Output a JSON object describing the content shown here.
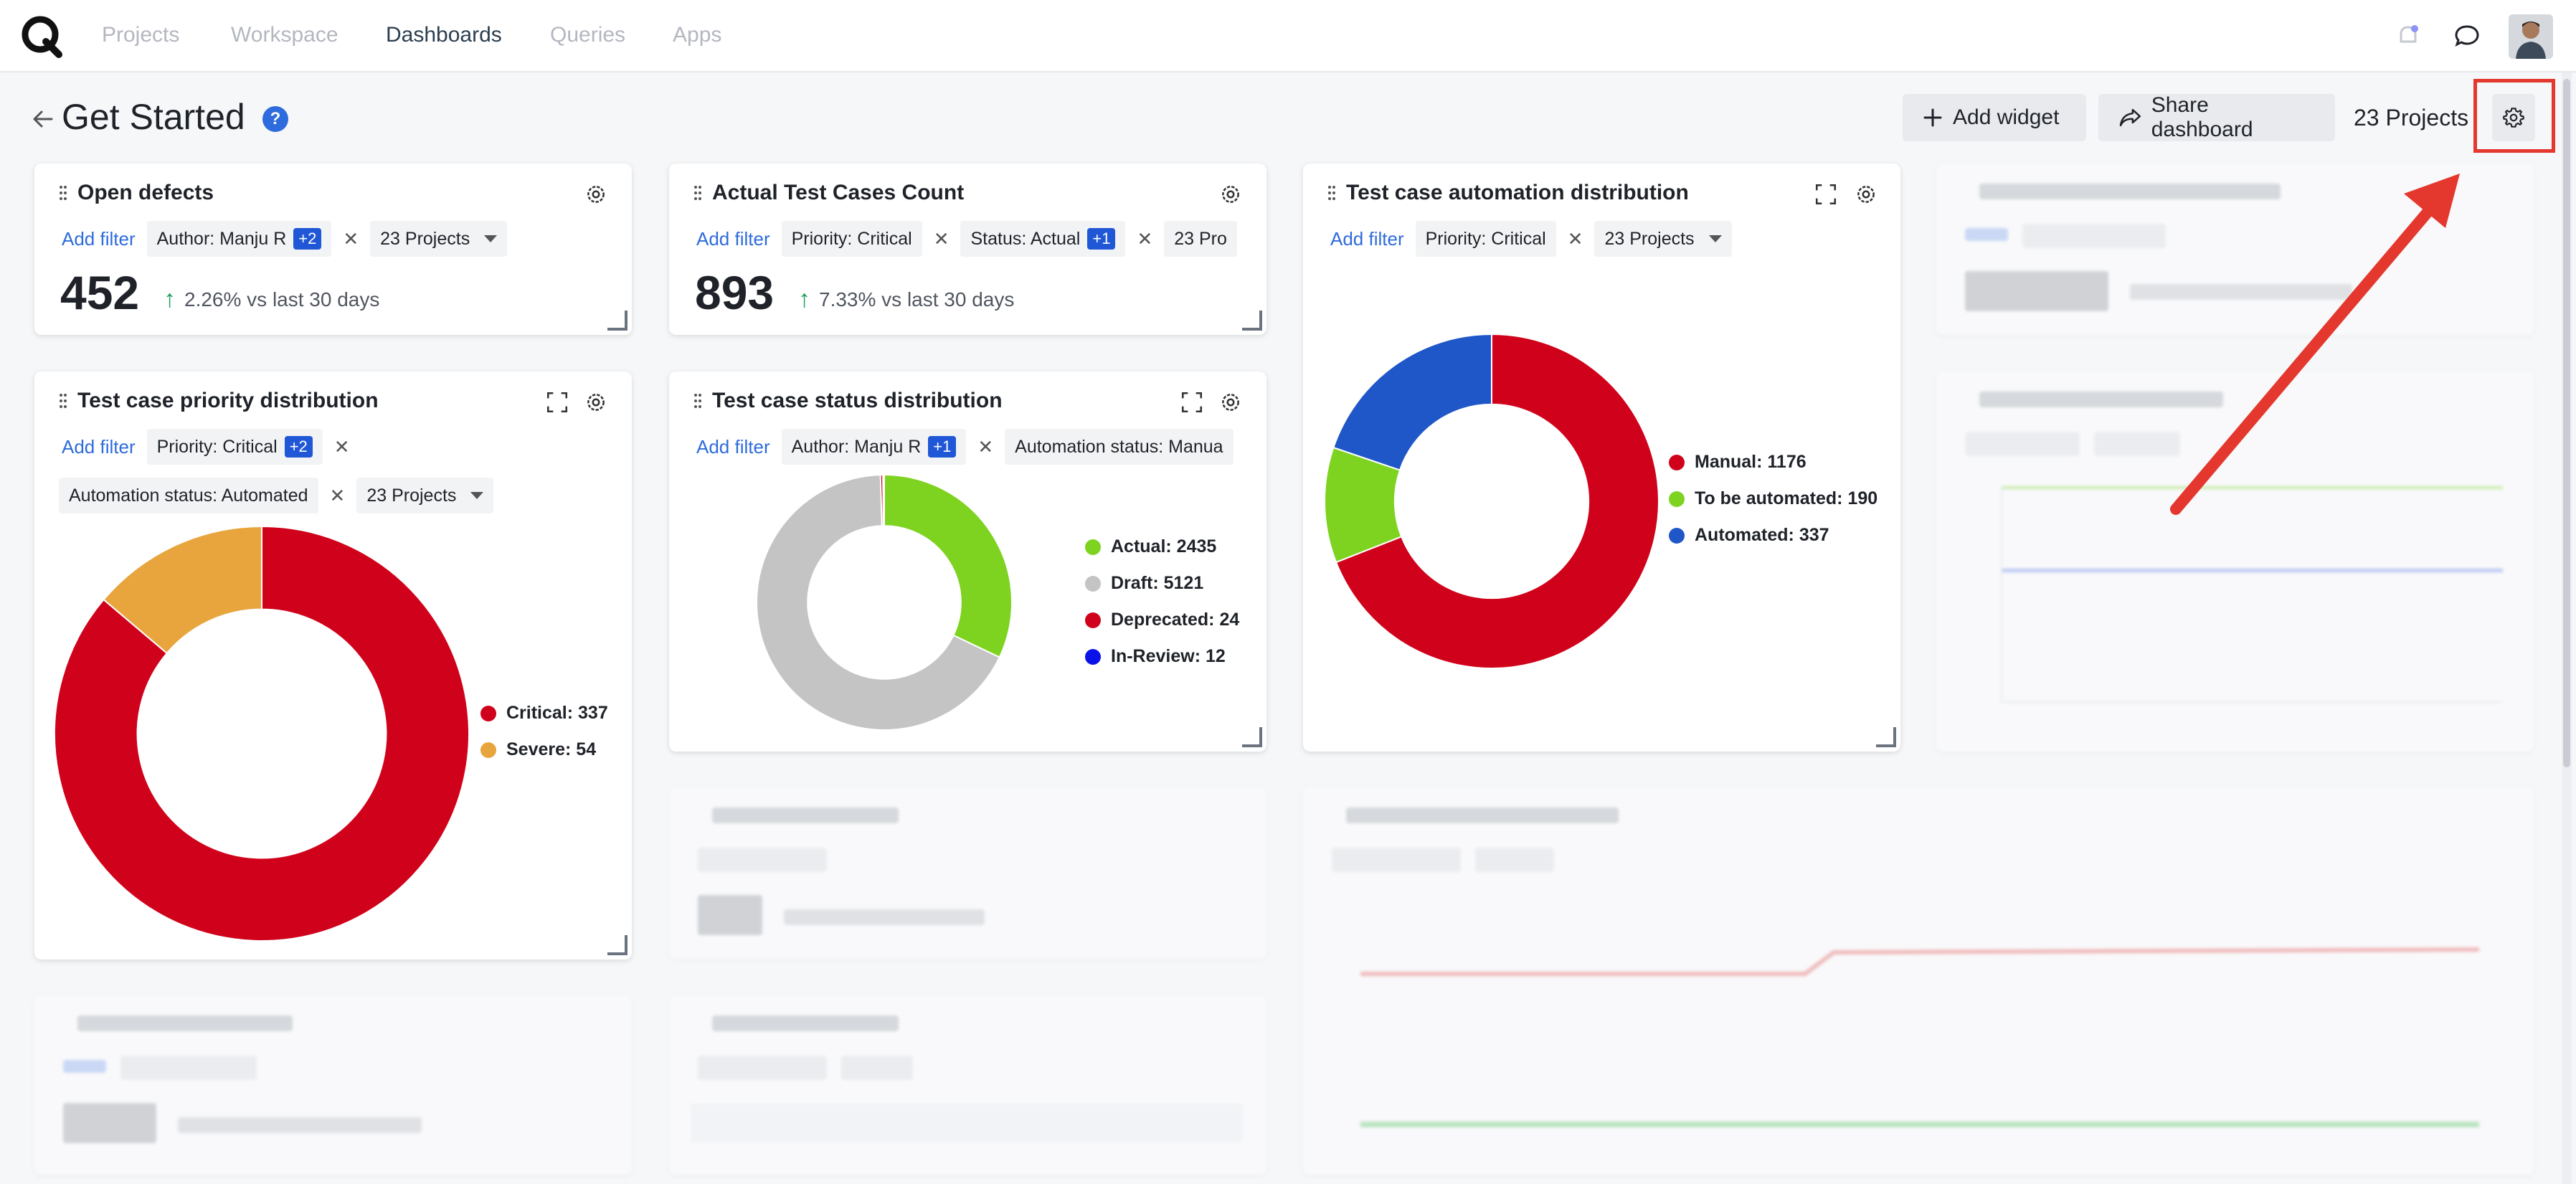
{
  "nav": {
    "items": [
      "Projects",
      "Workspace",
      "Dashboards",
      "Queries",
      "Apps"
    ],
    "active": "Dashboards"
  },
  "page": {
    "title": "Get Started",
    "add_widget": "Add widget",
    "share_dashboard": "Share dashboard",
    "projects_count": "23 Projects"
  },
  "widgets": {
    "open_defects": {
      "title": "Open defects",
      "add_filter": "Add filter",
      "filter_author": "Author: Manju R",
      "filter_author_badge": "+2",
      "filter_projects": "23 Projects",
      "value": "452",
      "trend": "2.26% vs last 30 days"
    },
    "actual_test_cases": {
      "title": "Actual Test Cases Count",
      "add_filter": "Add filter",
      "filter_priority": "Priority: Critical",
      "filter_status": "Status: Actual",
      "filter_status_badge": "+1",
      "filter_projects": "23 Pro",
      "value": "893",
      "trend": "7.33% vs last 30 days"
    },
    "automation_distribution": {
      "title": "Test case automation distribution",
      "add_filter": "Add filter",
      "filter_priority": "Priority: Critical",
      "filter_projects": "23 Projects",
      "legend": [
        "Manual: 1176",
        "To be automated: 190",
        "Automated: 337"
      ]
    },
    "priority_distribution": {
      "title": "Test case priority distribution",
      "add_filter": "Add filter",
      "filter_priority": "Priority: Critical",
      "filter_priority_badge": "+2",
      "filter_automation": "Automation status: Automated",
      "filter_projects": "23 Projects",
      "legend": [
        "Critical: 337",
        "Severe: 54"
      ]
    },
    "status_distribution": {
      "title": "Test case status distribution",
      "add_filter": "Add filter",
      "filter_author": "Author: Manju R",
      "filter_author_badge": "+1",
      "filter_automation": "Automation status: Manua",
      "legend": [
        "Actual: 2435",
        "Draft: 5121",
        "Deprecated: 24",
        "In-Review: 12"
      ]
    }
  },
  "chart_data": [
    {
      "type": "pie",
      "title": "Test case automation distribution",
      "categories": [
        "Manual",
        "To be automated",
        "Automated"
      ],
      "values": [
        1176,
        190,
        337
      ],
      "colors": [
        "#d0021b",
        "#7ed321",
        "#1f57c8"
      ]
    },
    {
      "type": "pie",
      "title": "Test case priority distribution",
      "categories": [
        "Critical",
        "Severe"
      ],
      "values": [
        337,
        54
      ],
      "colors": [
        "#d0021b",
        "#e8a53d"
      ]
    },
    {
      "type": "pie",
      "title": "Test case status distribution",
      "categories": [
        "Actual",
        "Draft",
        "Deprecated",
        "In-Review"
      ],
      "values": [
        2435,
        5121,
        24,
        12
      ],
      "colors": [
        "#7ed321",
        "#c4c4c4",
        "#d0021b",
        "#0a12e8"
      ]
    }
  ],
  "colors": {
    "accent": "#2e6bdc",
    "highlight": "#e4372d",
    "trend_up": "#1aa05a"
  }
}
